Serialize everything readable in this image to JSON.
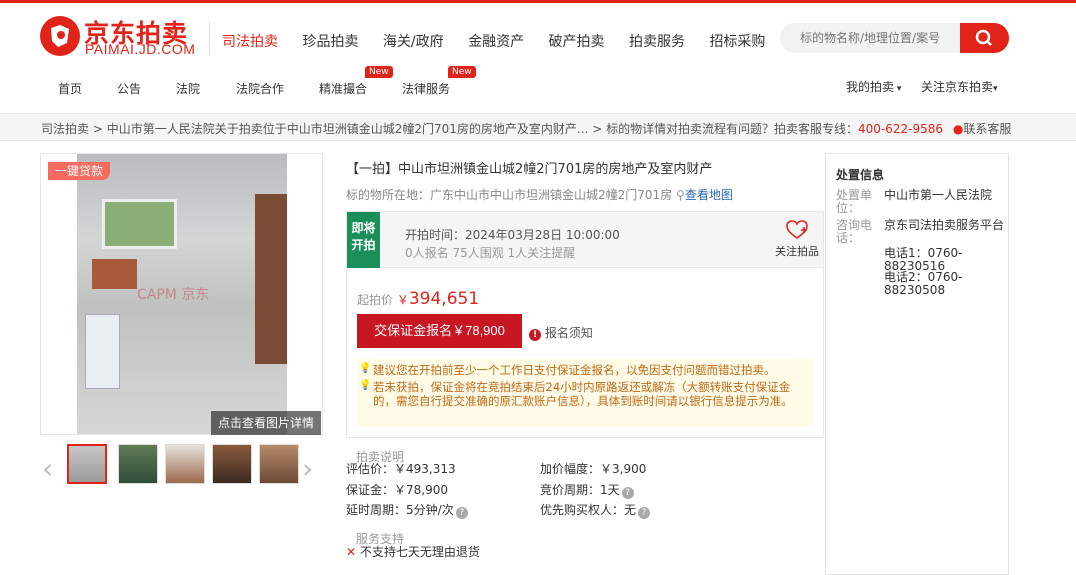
{
  "brand": {
    "name_cn": "京东拍卖",
    "name_en": "PAIMAI.JD.COM",
    "color": "#e2231a"
  },
  "mainnav": [
    "司法拍卖",
    "珍品拍卖",
    "海关/政府",
    "金融资产",
    "破产拍卖",
    "拍卖服务",
    "招标采购"
  ],
  "search": {
    "placeholder": "标的物名称/地理位置/案号"
  },
  "subnav": {
    "items": [
      "首页",
      "公告",
      "法院",
      "法院合作",
      "精准撮合",
      "法律服务"
    ],
    "new_badge": "New",
    "my_auction": "我的拍卖",
    "follow_jd": "关注京东拍卖"
  },
  "breadcrumb": {
    "items": [
      "司法拍卖",
      "中山市第一人民法院关于拍卖位于中山市坦洲镇金山城2幢2门701房的房地产及室内财产...",
      "标的物详情"
    ],
    "sep": ">",
    "help": "对拍卖流程有问题？拍卖客服专线：",
    "phone": "400-622-9586",
    "contact": "联系客服"
  },
  "gallery": {
    "loan_badge": "一键贷款",
    "watermark": "CAPM 京东",
    "view_details": "点击查看图片详情"
  },
  "item": {
    "title": "【一拍】中山市坦洲镇金山城2幢2门701房的房地产及室内财产",
    "location_label": "标的物所在地：",
    "location": "广东中山市中山市坦洲镇金山城2幢2门701房",
    "map_link": "查看地图"
  },
  "status": {
    "tag": "即将开拍",
    "start_label": "开拍时间：",
    "start_time": "2024年03月28日 10:00:00",
    "stats": "0人报名   75人围观   1人关注提醒",
    "follow": "关注拍品"
  },
  "price": {
    "label": "起拍价",
    "currency": "￥",
    "value": "394,651",
    "deposit_button": "交保证金报名￥78,900",
    "notice": "报名须知",
    "tips": [
      "建议您在开拍前至少一个工作日支付保证金报名，以免因支付问题而错过拍卖。",
      "若未获拍，保证金将在竞拍结束后24小时内原路返还或解冻（大额转账支付保证金的，需您自行提交准确的原汇款账户信息），具体到账时间请以银行信息提示为准。"
    ]
  },
  "auction_info": {
    "title": "拍卖说明",
    "rows": [
      {
        "k": "评估价：",
        "v": "￥493,313"
      },
      {
        "k": "加价幅度：",
        "v": "￥3,900"
      },
      {
        "k": "保证金：",
        "v": "￥78,900"
      },
      {
        "k": "竞价周期：",
        "v": "1天"
      },
      {
        "k": "延时周期：",
        "v": "5分钟/次"
      },
      {
        "k": "优先购买权人：",
        "v": "无"
      }
    ]
  },
  "service": {
    "title": "服务支持",
    "item": "不支持七天无理由退货"
  },
  "disposal": {
    "title": "处置信息",
    "unit_label": "处置单位：",
    "unit": "中山市第一人民法院",
    "contact_label": "咨询电话：",
    "contact_name": "京东司法拍卖服务平台",
    "phone1": "电话1：0760-88230516",
    "phone2": "电话2：0760-88230508"
  }
}
